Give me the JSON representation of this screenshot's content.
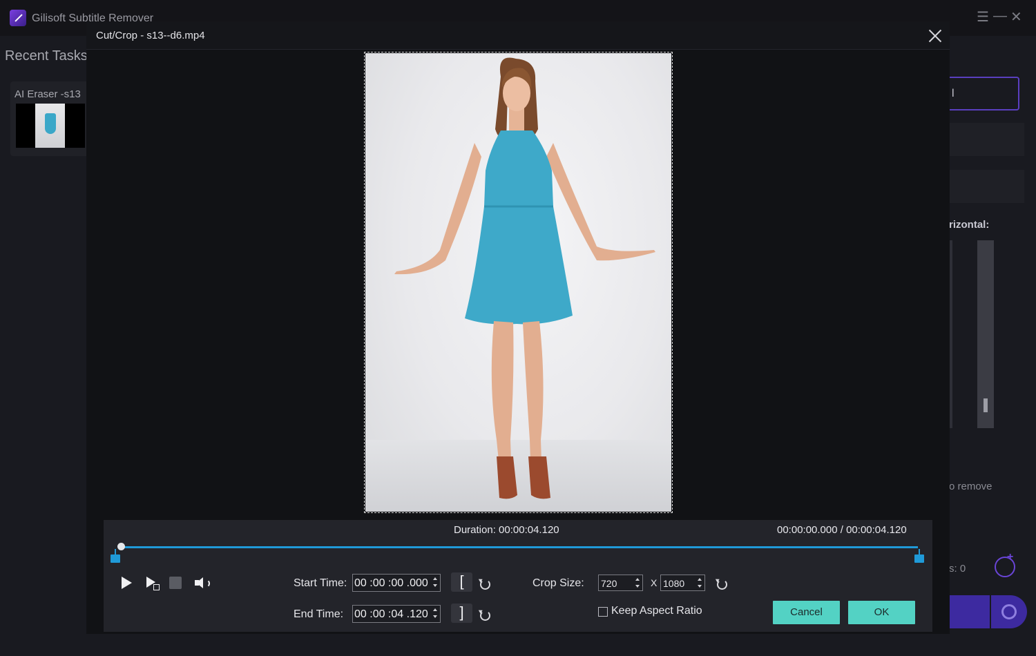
{
  "app": {
    "title": "Gilisoft Subtitle Remover",
    "menu_icon": "☰",
    "minimize_icon": "—",
    "close_icon": "✕"
  },
  "sidebar": {
    "recent_title": "Recent Tasks",
    "tasks": [
      {
        "label": "AI Eraser -s13"
      }
    ]
  },
  "right_panel": {
    "horizontal_label": "rizontal:",
    "remove_text": "o remove",
    "count_text": "s: 0"
  },
  "dialog": {
    "title": "Cut/Crop - s13--d6.mp4",
    "duration_label": "Duration:",
    "duration_value": "00:00:04.120",
    "timecode": "00:00:00.000 / 00:00:04.120",
    "start_time_label": "Start Time:",
    "start_time_value": "00 :00 :00 .000",
    "end_time_label": "End Time:",
    "end_time_value": "00 :00 :04 .120",
    "set_start_label": "[",
    "set_end_label": "]",
    "crop_size_label": "Crop Size:",
    "crop_width": "720",
    "crop_separator": "X",
    "crop_height": "1080",
    "keep_aspect_label": "Keep Aspect Ratio",
    "keep_aspect_checked": false,
    "cancel_label": "Cancel",
    "ok_label": "OK",
    "playback_position_fraction": 0.0,
    "accent_color": "#1f9ad8",
    "button_color": "#53d2c4"
  }
}
